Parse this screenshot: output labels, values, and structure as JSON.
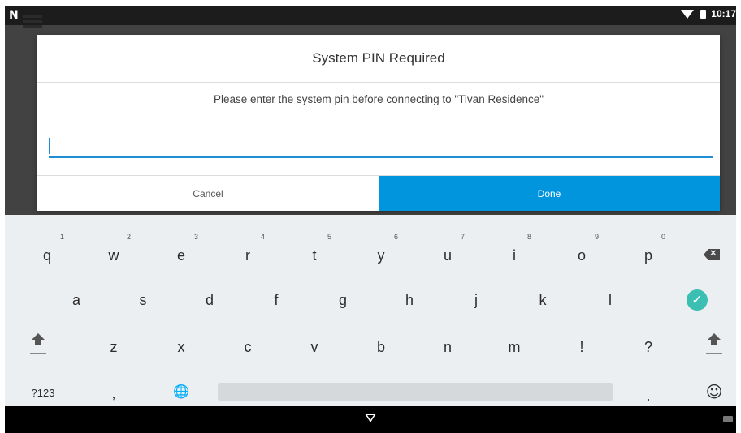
{
  "status_bar": {
    "logo": "N",
    "time": "10:17"
  },
  "dialog": {
    "title": "System PIN Required",
    "message": "Please enter the system pin before connecting to \"Tivan Residence\"",
    "pin_value": "",
    "cancel_label": "Cancel",
    "done_label": "Done",
    "accent_color": "#0095dc"
  },
  "keyboard": {
    "row1": [
      {
        "key": "q",
        "hint": "1"
      },
      {
        "key": "w",
        "hint": "2"
      },
      {
        "key": "e",
        "hint": "3"
      },
      {
        "key": "r",
        "hint": "4"
      },
      {
        "key": "t",
        "hint": "5"
      },
      {
        "key": "y",
        "hint": "6"
      },
      {
        "key": "u",
        "hint": "7"
      },
      {
        "key": "i",
        "hint": "8"
      },
      {
        "key": "o",
        "hint": "9"
      },
      {
        "key": "p",
        "hint": "0"
      }
    ],
    "row2": [
      "a",
      "s",
      "d",
      "f",
      "g",
      "h",
      "j",
      "k",
      "l"
    ],
    "row3": [
      "z",
      "x",
      "c",
      "v",
      "b",
      "n",
      "m",
      "!",
      "?"
    ],
    "symbols_label": "?123",
    "comma": ",",
    "period": ".",
    "globe_icon": "🌐",
    "emoji_icon": "☺",
    "enter_icon": "✓",
    "backspace_icon": "backspace-icon",
    "shift_icon": "shift-icon"
  },
  "nav_bar": {
    "back_icon": "back-triangle-icon",
    "keyboard_icon": "keyboard-icon"
  }
}
